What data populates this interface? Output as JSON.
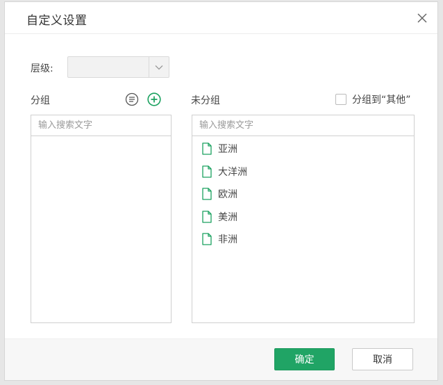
{
  "dialog": {
    "title": "自定义设置",
    "close_icon": "close-icon"
  },
  "level": {
    "label": "层级:",
    "selected": ""
  },
  "groups": {
    "label": "分组",
    "sort_icon": "sort-list-icon",
    "add_icon": "add-circle-icon",
    "search_placeholder": "输入搜索文字",
    "items": []
  },
  "ungrouped": {
    "label": "未分组",
    "group_to_other_label": "分组到“其他”",
    "group_to_other_checked": false,
    "search_placeholder": "输入搜索文字",
    "item_icon": "file-icon",
    "items": [
      {
        "label": "亚洲"
      },
      {
        "label": "大洋洲"
      },
      {
        "label": "欧洲"
      },
      {
        "label": "美洲"
      },
      {
        "label": "非洲"
      }
    ]
  },
  "footer": {
    "confirm_label": "确定",
    "cancel_label": "取消"
  },
  "colors": {
    "accent": "#20a465",
    "icon_green": "#1aa15f"
  }
}
